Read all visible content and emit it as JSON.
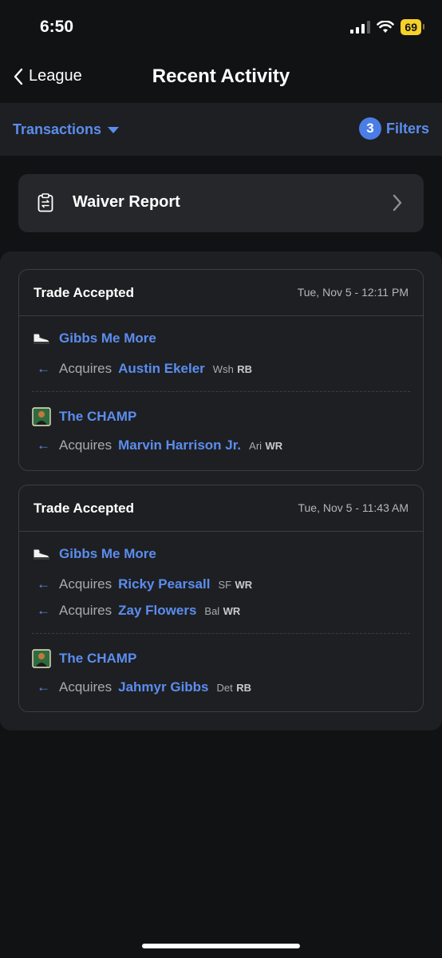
{
  "status": {
    "time": "6:50",
    "battery": "69",
    "battery_color": "#f5d12a"
  },
  "nav": {
    "back_label": "League",
    "title": "Recent Activity"
  },
  "filter_bar": {
    "transactions_label": "Transactions",
    "filter_count": "3",
    "filters_label": "Filters",
    "accent_color": "#5b8def"
  },
  "waiver": {
    "label": "Waiver Report"
  },
  "trades": [
    {
      "title": "Trade Accepted",
      "date": "Tue, Nov 5 - 12:11 PM",
      "teams": [
        {
          "name": "Gibbs Me More",
          "icon": "sneaker-icon",
          "acquires": [
            {
              "label": "Acquires",
              "player": "Austin Ekeler",
              "team": "Wsh",
              "pos": "RB"
            }
          ]
        },
        {
          "name": "The CHAMP",
          "icon": "champ-avatar-icon",
          "acquires": [
            {
              "label": "Acquires",
              "player": "Marvin Harrison Jr.",
              "team": "Ari",
              "pos": "WR"
            }
          ]
        }
      ]
    },
    {
      "title": "Trade Accepted",
      "date": "Tue, Nov 5 - 11:43 AM",
      "teams": [
        {
          "name": "Gibbs Me More",
          "icon": "sneaker-icon",
          "acquires": [
            {
              "label": "Acquires",
              "player": "Ricky Pearsall",
              "team": "SF",
              "pos": "WR"
            },
            {
              "label": "Acquires",
              "player": "Zay Flowers",
              "team": "Bal",
              "pos": "WR"
            }
          ]
        },
        {
          "name": "The CHAMP",
          "icon": "champ-avatar-icon",
          "acquires": [
            {
              "label": "Acquires",
              "player": "Jahmyr Gibbs",
              "team": "Det",
              "pos": "RB"
            }
          ]
        }
      ]
    }
  ]
}
